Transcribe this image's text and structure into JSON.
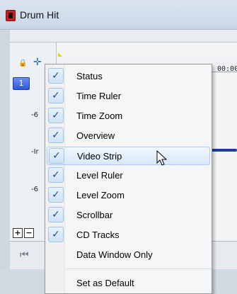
{
  "window": {
    "title": "Drum Hit"
  },
  "track": {
    "number": "1",
    "db_labels": [
      "-6",
      "-Ir",
      "-6"
    ]
  },
  "ruler": {
    "time_text": "00:00"
  },
  "menu": {
    "items": [
      {
        "label": "Status",
        "checked": true
      },
      {
        "label": "Time Ruler",
        "checked": true
      },
      {
        "label": "Time Zoom",
        "checked": true
      },
      {
        "label": "Overview",
        "checked": true
      },
      {
        "label": "Video Strip",
        "checked": true,
        "hover": true
      },
      {
        "label": "Level Ruler",
        "checked": true
      },
      {
        "label": "Level Zoom",
        "checked": true
      },
      {
        "label": "Scrollbar",
        "checked": true
      },
      {
        "label": "CD Tracks",
        "checked": true
      },
      {
        "label": "Data Window Only",
        "checked": false
      }
    ],
    "footer_item": "Set as Default",
    "check_glyph": "✓"
  },
  "controls": {
    "plus": "+",
    "minus": "−",
    "go_start": "⏮"
  }
}
